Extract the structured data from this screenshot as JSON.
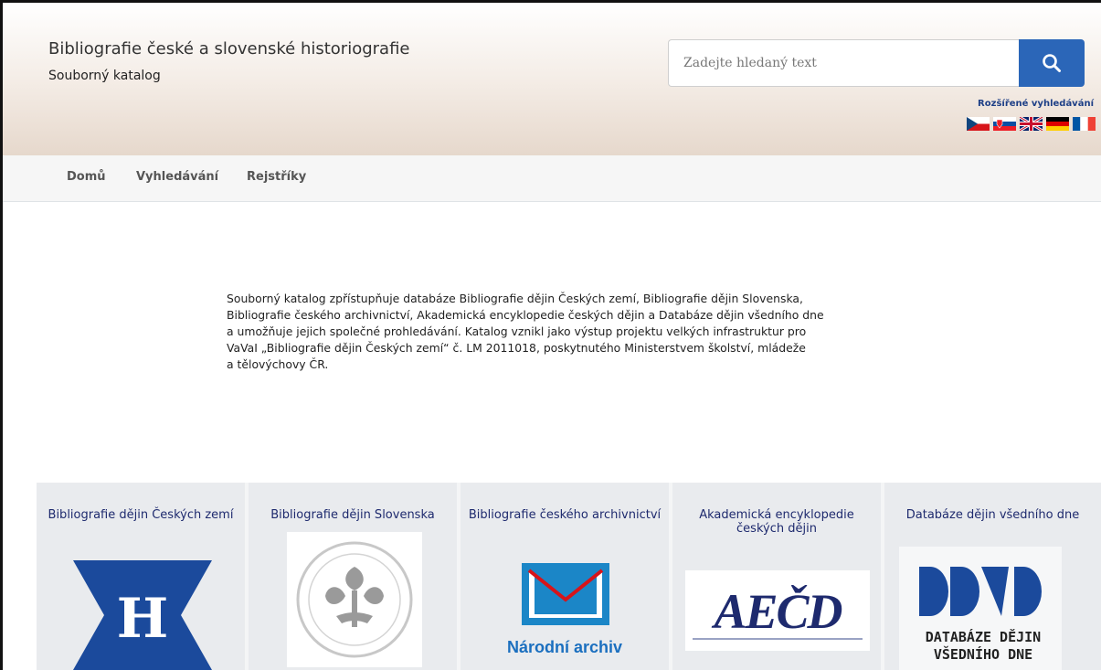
{
  "header": {
    "title": "Bibliografie české a slovenské historiografie",
    "subtitle": "Souborný katalog",
    "search": {
      "placeholder": "Zadejte hledaný text",
      "button_icon": "search-icon"
    },
    "advanced_search": "Rozšířené vyhledávání",
    "flags": [
      "cz-flag",
      "sk-flag",
      "uk-flag",
      "de-flag",
      "fr-flag"
    ]
  },
  "nav": {
    "items": [
      "Domů",
      "Vyhledávání",
      "Rejstříky"
    ]
  },
  "intro": {
    "lines": [
      "Souborný katalog zpřístupňuje databáze Bibliografie dějin Českých zemí, Bibliografie dějin Slovenska,",
      "Bibliografie českého archivnictví, Akademická encyklopedie českých dějin a  Databáze dějin všedního dne",
      "a umožňuje jejich společné prohledávání. Katalog vznikl jako výstup projektu velkých infrastruktur pro",
      "VaVaI „Bibliografie dějin Českých zemí“ č. LM 2011018, poskytnutého Ministerstvem školství, mládeže",
      "a tělovýchovy ČR."
    ]
  },
  "cards": [
    {
      "title": "Bibliografie dějin Českých zemí",
      "logo": "H"
    },
    {
      "title": "Bibliografie dějin Slovenska",
      "logo": "academy-seal"
    },
    {
      "title": "Bibliografie českého archivnictví",
      "logo": "Národní archiv"
    },
    {
      "title": "Akademická encyklopedie českých dějin",
      "logo": "AEČD"
    },
    {
      "title": "Databáze dějin všedního dne",
      "logo": "DATABÁZE DĚJIN VŠEDNÍHO DNE"
    }
  ],
  "colors": {
    "accent": "#2b66b8",
    "link": "#1d3f86",
    "card_title": "#1e2a6e",
    "logo_blue": "#1b4a9c"
  }
}
